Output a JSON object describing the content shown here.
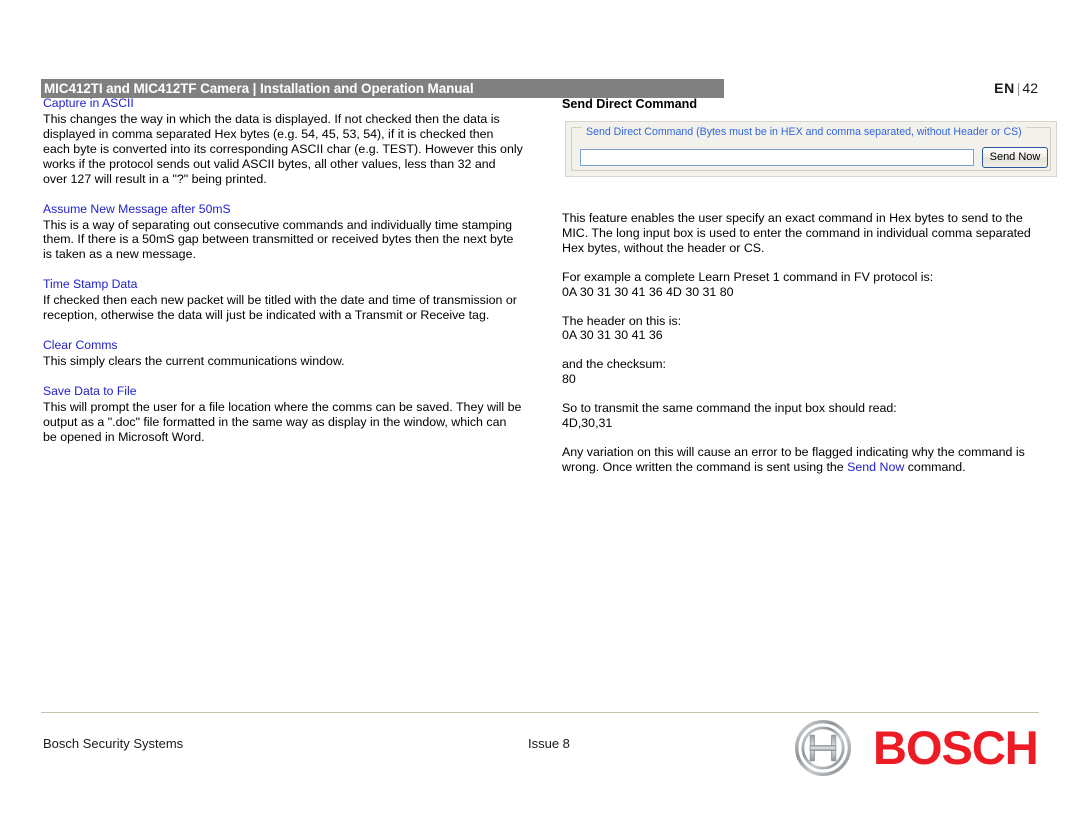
{
  "header": {
    "title": "MIC412TI and MIC412TF Camera | Installation and Operation Manual",
    "lang": "EN",
    "separator": "|",
    "page_number": "42"
  },
  "left_column": {
    "sections": [
      {
        "heading": "Capture in ASCII",
        "body": "This changes the way in which the data is displayed. If not checked then the data is displayed in comma separated Hex bytes (e.g. 54, 45, 53, 54), if it is checked then each byte is converted into its corresponding ASCII char (e.g. TEST). However this only works if the protocol sends out valid ASCII bytes, all other values, less than 32 and over 127 will result in a \"?\" being printed."
      },
      {
        "heading": "Assume New Message after 50mS",
        "body": "This is a way of separating out consecutive commands and individually time stamping them. If there is a 50mS gap between transmitted or received bytes then the next byte is taken as a new message."
      },
      {
        "heading": "Time Stamp Data",
        "body": "If checked then each new packet will be titled with the date and time of transmission or reception, otherwise the data will just be indicated with a Transmit or Receive tag."
      },
      {
        "heading": "Clear Comms",
        "body": "This simply clears the current communications window."
      },
      {
        "heading": "Save Data to File",
        "body": "This will prompt the user for a file location where the comms can be saved. They will be output as a \".doc\" file formatted in the same way as display in the window, which can be opened in Microsoft Word."
      }
    ]
  },
  "right_column": {
    "heading": "Send Direct Command",
    "widget": {
      "legend": "Send Direct Command (Bytes must be in HEX and comma separated, without Header or CS)",
      "input_value": "",
      "input_placeholder": "",
      "button_label": "Send Now"
    },
    "paragraphs": {
      "intro": "This feature enables the user specify an exact command in Hex bytes to send to the MIC. The long input box is used to enter the command in individual comma separated Hex bytes, without the header or CS.",
      "example_label": " For example a complete Learn Preset 1 command in FV protocol is:",
      "example_value": "0A 30 31 30 41 36 4D 30 31 80",
      "header_label": "The header on this is:",
      "header_value": "0A 30 31 30 41 36",
      "checksum_label": "and the checksum:",
      "checksum_value": "80",
      "inputbox_label": "So to transmit the same command the input box should read:",
      "inputbox_value": "4D,30,31",
      "closing_prefix": "Any variation on this will cause an error to be flagged indicating why the command is wrong. Once written the command is sent using the ",
      "closing_link": "Send Now",
      "closing_suffix": " command."
    }
  },
  "footer": {
    "left": "Bosch Security Systems",
    "center": "Issue 8",
    "logo_text": "BOSCH"
  },
  "colors": {
    "heading_blue": "#2222CC",
    "legend_blue": "#3366DD",
    "header_bar_gray": "#808080",
    "logo_red": "#ED1C24",
    "rule_tan": "#C9C4A8"
  }
}
